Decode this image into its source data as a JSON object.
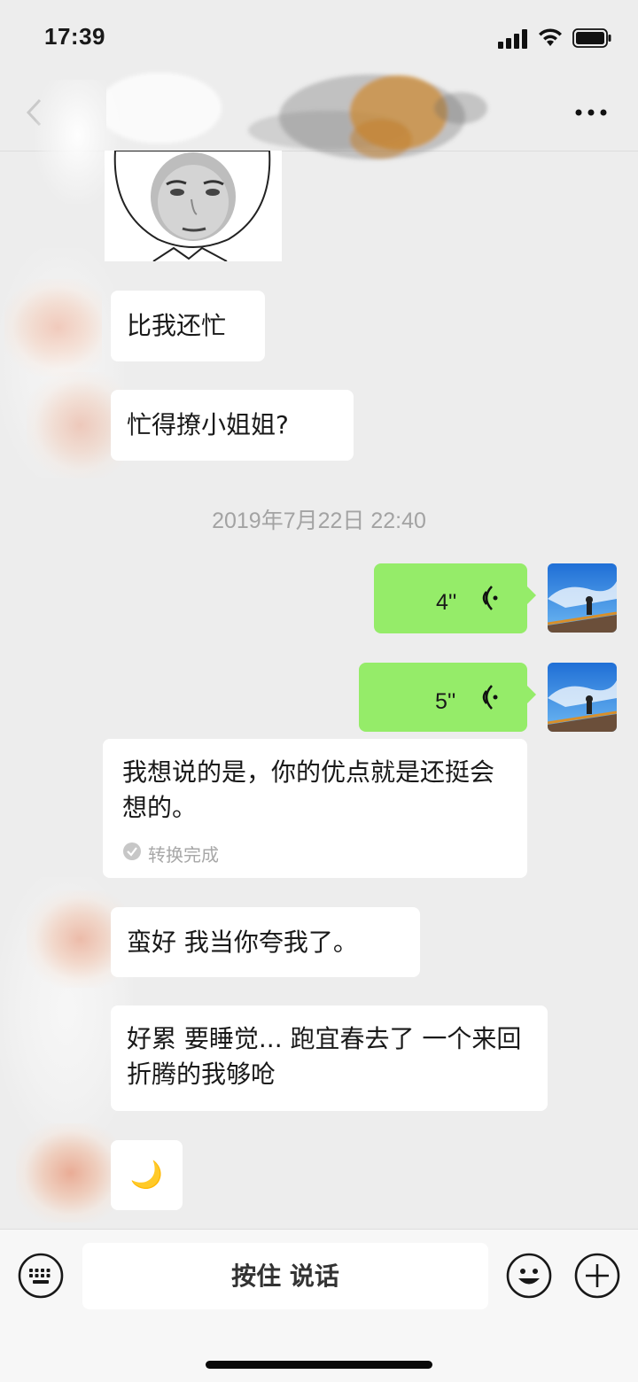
{
  "status_bar": {
    "time": "17:39"
  },
  "nav": {
    "title": ""
  },
  "messages": {
    "m1": "比我还忙",
    "m2": "忙得撩小姐姐?",
    "timestamp": "2019年7月22日 22:40",
    "voice1_duration": "4''",
    "voice2_duration": "5''",
    "transcript": "我想说的是，你的优点就是还挺会想的。",
    "transcript_status": "转换完成",
    "m3": "蛮好 我当你夸我了。",
    "m4": "好累 要睡觉... 跑宜春去了 一个来回折腾的我够呛",
    "m5_emoji": "🌙"
  },
  "input_bar": {
    "hold_to_talk": "按住 说话"
  },
  "colors": {
    "background": "#ededed",
    "bubble_green": "#95ec69",
    "bubble_white": "#ffffff",
    "timestamp": "#a3a3a3"
  },
  "icons": [
    "signal-icon",
    "wifi-icon",
    "battery-icon",
    "back-icon",
    "more-icon",
    "voice-wave-icon",
    "check-icon",
    "keyboard-icon",
    "emoji-icon",
    "plus-icon"
  ]
}
